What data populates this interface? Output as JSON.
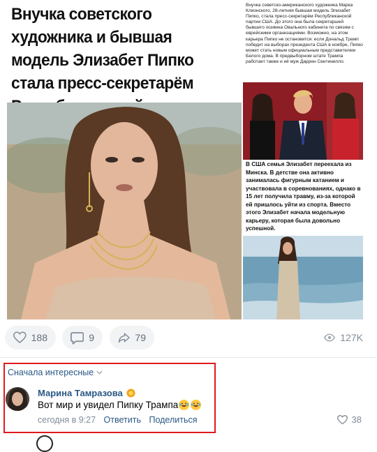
{
  "post": {
    "headline": "Внучка советского художника и бывшая модель Элизабет Пипко стала пресс-секретарём Республиканской партии США",
    "side_text_1": "Внучка советско-американского художника Марка Клионского, 28-летняя бывшая модель Элизабет Пипко, стала пресс-секретарём Республиканской партии США. До этого она была секретаршей бывшего хозяина Овального кабинета по связям с еврейскими организациями. Возможно, на этом карьера Пипко не остановится: если Дональд Трамп победит на выборах президента США в ноябре, Пипко может стать новым официальным представителем Белого дома. В предвыборном штате Трампа работает также и её муж Даррен Сентинелло.",
    "side_text_2": "В США семья Элизабет переехала из Минска. В детстве она активно занималась фигурным катанием и участвовала в соревнованиях, однако в 15 лет получила травму, из-за которой ей пришлось уйти из спорта. Вместо этого Элизабет начала модельную карьеру, которая была довольно успешной."
  },
  "actions": {
    "likes": "188",
    "comments": "9",
    "shares": "79",
    "views": "127K"
  },
  "comments": {
    "sort_label": "Сначала интересные",
    "items": [
      {
        "author": "Марина Тамразова",
        "text": "Вот мир и увидел Пипку Трампа",
        "time": "сегодня в 9:27",
        "reply_label": "Ответить",
        "share_label": "Поделиться",
        "likes": "38"
      }
    ]
  },
  "colors": {
    "link": "#2a5885",
    "muted": "#818c99",
    "highlight": "#e0191d"
  }
}
